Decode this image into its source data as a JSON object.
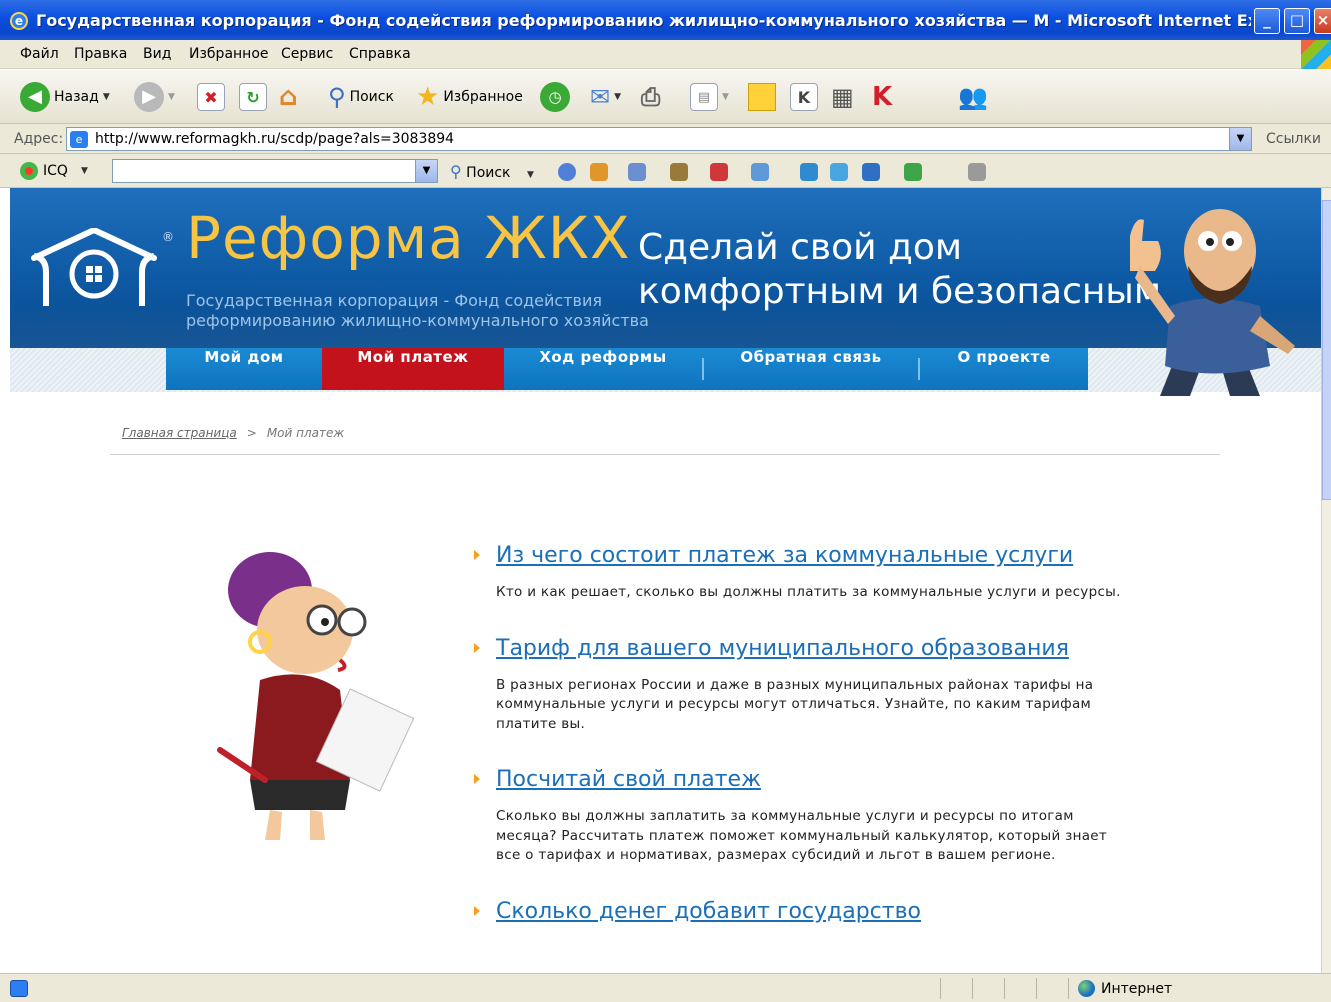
{
  "window": {
    "title": "Государственная корпорация - Фонд содействия реформированию жилищно-коммунального хозяйства — M - Microsoft Internet Explorer",
    "minimize": "_",
    "maximize": "□",
    "close": "×"
  },
  "menu": [
    "Файл",
    "Правка",
    "Вид",
    "Избранное",
    "Сервис",
    "Справка"
  ],
  "toolbar": {
    "back": "Назад",
    "search": "Поиск",
    "favorites": "Избранное"
  },
  "address": {
    "label": "Адрес:",
    "url": "http://www.reformagkh.ru/scdp/page?als=3083894",
    "links": "Ссылки"
  },
  "icq_bar": {
    "icq_label": "ICQ",
    "search_value": "",
    "search_button": "Поиск"
  },
  "site": {
    "brand": "Реформа ЖКХ",
    "brand_reg": "®",
    "brand_sub": "Государственная корпорация - Фонд содействия реформированию жилищно-коммунального хозяйства",
    "slogan_line1": "Сделай свой дом",
    "slogan_line2": "комфортным и безопасным",
    "nav": [
      "Мой дом",
      "Мой платеж",
      "Ход реформы",
      "Обратная связь",
      "О проекте"
    ],
    "active_nav": "Мой платеж",
    "breadcrumb": {
      "home": "Главная страница",
      "separator": ">",
      "current": "Мой платеж"
    },
    "items": [
      {
        "title": "Из чего состоит платеж за коммунальные услуги",
        "description": "Кто и как решает, сколько вы должны платить за коммунальные услуги и ресурсы."
      },
      {
        "title": "Тариф для вашего муниципального образования",
        "description": "В разных регионах России и даже в разных муниципальных районах тарифы на коммунальные услуги и ресурсы могут отличаться. Узнайте, по каким тарифам платите вы."
      },
      {
        "title": "Посчитай свой платеж",
        "description": "Сколько вы должны заплатить за коммунальные услуги и ресурсы по итогам месяца? Рассчитать платеж поможет коммунальный калькулятор, который знает все о тарифах и нормативах, размерах субсидий и льгот в вашем регионе."
      },
      {
        "title": "Сколько денег добавит государство",
        "description": ""
      }
    ]
  },
  "status": {
    "zone": "Интернет"
  },
  "colors": {
    "title_bar": "#0b4fe0",
    "banner": "#0e5aa5",
    "brand_yellow": "#f8c443",
    "nav_blue": "#1b8ad3",
    "nav_active_red": "#c4121d",
    "link_blue": "#1b6fb8",
    "bullet_orange": "#f4a020"
  }
}
